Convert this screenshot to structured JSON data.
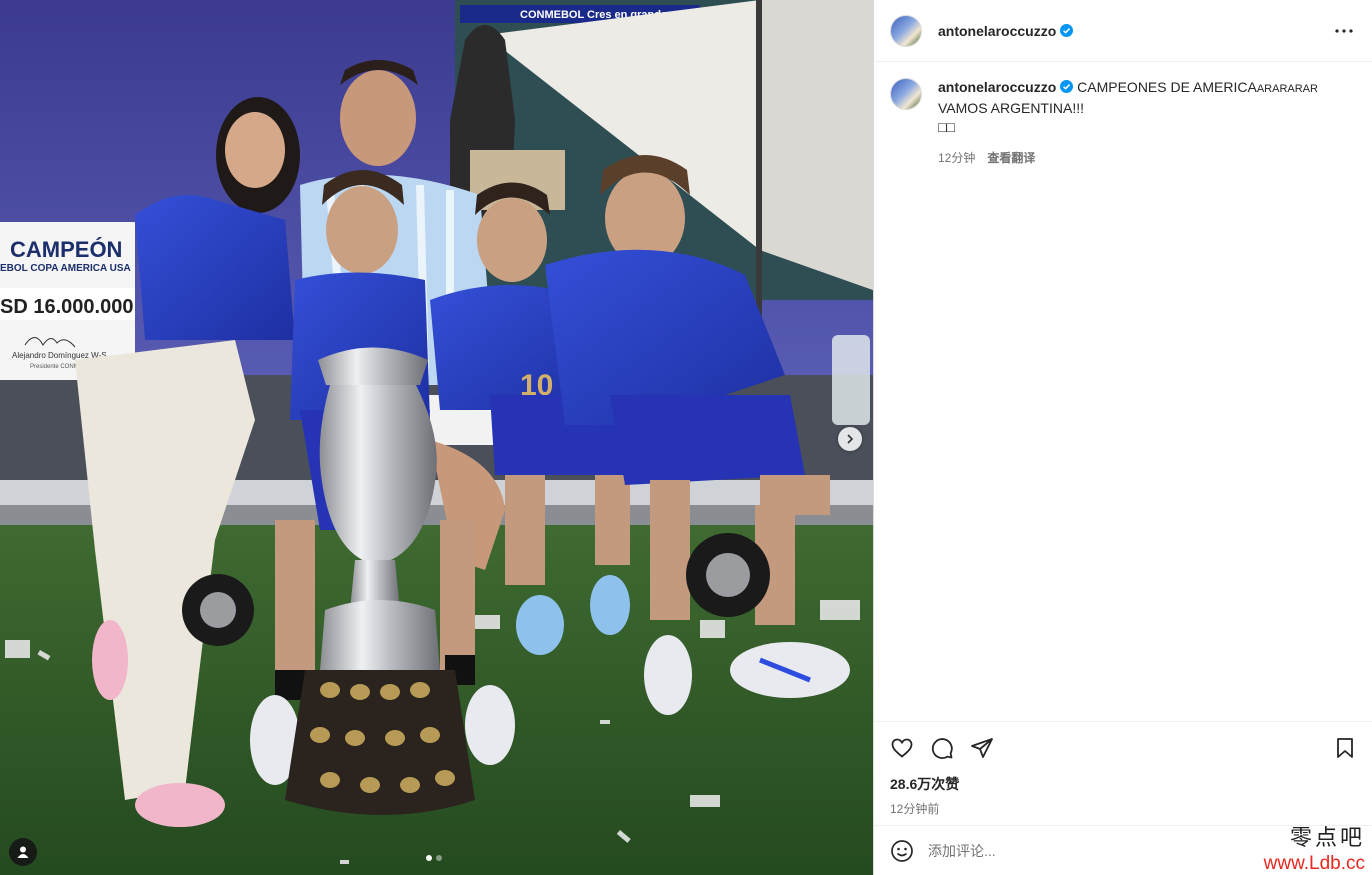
{
  "post": {
    "username": "antonelaroccuzzo",
    "caption_username": "antonelaroccuzzo",
    "caption_line1": "CAMPEONES DE AMERICA",
    "caption_line1_suffix": "ARARARAR",
    "caption_line2": "VAMOS ARGENTINA!!!",
    "caption_line3": "□□",
    "caption_time": "12分钟",
    "translate_label": "查看翻译",
    "likes": "28.6万次赞",
    "posted_time": "12分钟前",
    "comment_placeholder": "添加评论..."
  },
  "media": {
    "banner_title": "CAMPEÓN",
    "banner_sub": "EBOL COPA AMERICA USA",
    "banner_amount": "SD 16.000.000",
    "banner_sign_name": "Alejandro Domínguez W-S.",
    "banner_sign_role": "Presidente CONMEBOL",
    "board_text": "CONMEBOL  Cres en grande",
    "carousel_count": 2,
    "carousel_active": 0
  },
  "watermark": {
    "line1": "零点吧",
    "line2": "www.Ldb.cc"
  },
  "colors": {
    "verified": "#0095f6",
    "kit_blue": "#2a3fc4",
    "pitch_green": "#2f5a2a"
  }
}
